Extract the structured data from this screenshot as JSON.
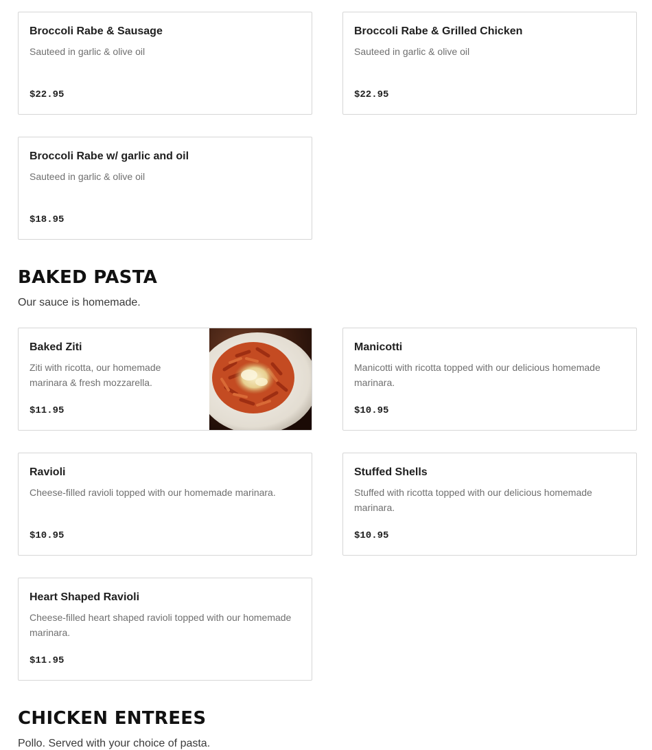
{
  "sections": [
    {
      "id": "broccoli-rabe",
      "items": [
        {
          "name": "Broccoli Rabe & Sausage",
          "description": "Sauteed in garlic & olive oil",
          "price": "$22.95"
        },
        {
          "name": "Broccoli Rabe & Grilled Chicken",
          "description": "Sauteed in garlic & olive oil",
          "price": "$22.95"
        },
        {
          "name": "Broccoli Rabe w/ garlic and oil",
          "description": "Sauteed in garlic & olive oil",
          "price": "$18.95"
        }
      ]
    },
    {
      "id": "baked-pasta",
      "title": "BAKED PASTA",
      "subtitle": "Our sauce is homemade.",
      "items": [
        {
          "name": "Baked Ziti",
          "description": "Ziti with ricotta, our homemade marinara & fresh mozzarella.",
          "price": "$11.95",
          "photo": "baked-ziti-photo"
        },
        {
          "name": "Manicotti",
          "description": "Manicotti with ricotta topped with our delicious homemade marinara.",
          "price": "$10.95"
        },
        {
          "name": "Ravioli",
          "description": "Cheese-filled ravioli topped with our homemade marinara.",
          "price": "$10.95"
        },
        {
          "name": "Stuffed Shells",
          "description": "Stuffed with ricotta topped with our delicious homemade marinara.",
          "price": "$10.95"
        },
        {
          "name": "Heart Shaped Ravioli",
          "description": "Cheese-filled heart shaped ravioli topped with our homemade marinara.",
          "price": "$11.95"
        }
      ]
    },
    {
      "id": "chicken-entrees",
      "title": "CHICKEN ENTREES",
      "subtitle": "Pollo. Served with your choice of pasta."
    }
  ],
  "colors": {
    "card_border": "#d6d6d6",
    "title_text": "#111111",
    "description_text": "#6f6f6f",
    "price_text": "#202020"
  }
}
